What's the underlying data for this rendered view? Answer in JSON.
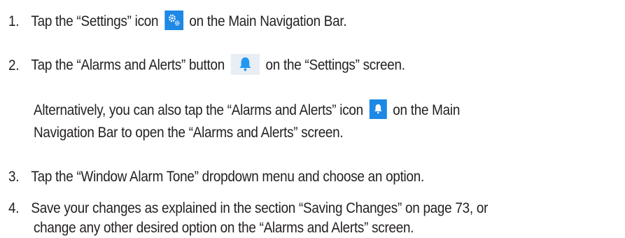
{
  "steps": [
    {
      "number": "1.",
      "text_before": "Tap the “Settings” icon",
      "icon": "settings-gears-icon",
      "text_after": "on the Main Navigation Bar."
    },
    {
      "number": "2.",
      "text_before": "Tap the “Alarms and Alerts” button",
      "icon": "bell-icon",
      "text_after": "on the “Settings” screen."
    },
    {
      "number": "3.",
      "text": "Tap the “Window Alarm Tone” dropdown menu and choose an option."
    },
    {
      "number": "4.",
      "line1": "Save your changes as explained in the section “Saving Changes” on page 73, or",
      "line2": "change any other desired option on the “Alarms and Alerts” screen."
    }
  ],
  "alternative_note": {
    "line1_before": "Alternatively, you can also tap the “Alarms and Alerts” icon",
    "icon": "bell-icon",
    "line1_after": "on the Main",
    "line2": "Navigation Bar to open the “Alarms and Alerts” screen."
  },
  "colors": {
    "text": "#231f20",
    "icon_tile": "#1e88e5",
    "button_tile": "#e8eef4",
    "bell_blue": "#2196f3"
  }
}
